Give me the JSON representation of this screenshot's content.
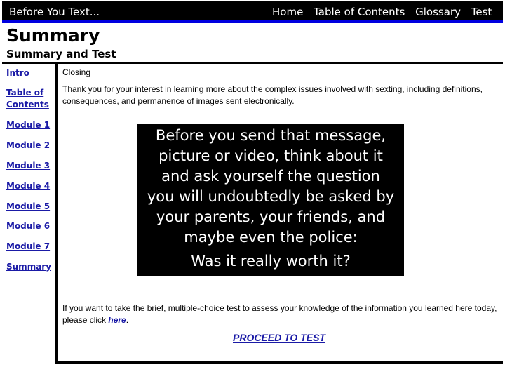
{
  "header": {
    "site_title": "Before You Text...",
    "nav": [
      "Home",
      "Table of Contents",
      "Glossary",
      "Test"
    ]
  },
  "page": {
    "title": "Summary",
    "subtitle": "Summary and Test"
  },
  "sidebar": {
    "items": [
      {
        "line1": "Intro",
        "line2": ""
      },
      {
        "line1": "Table of",
        "line2": "Contents"
      },
      {
        "line1": "Module 1",
        "line2": ""
      },
      {
        "line1": "Module 2",
        "line2": ""
      },
      {
        "line1": "Module 3",
        "line2": ""
      },
      {
        "line1": "Module 4",
        "line2": ""
      },
      {
        "line1": "Module 5",
        "line2": ""
      },
      {
        "line1": "Module 6",
        "line2": ""
      },
      {
        "line1": "Module 7",
        "line2": ""
      },
      {
        "line1": "Summary",
        "line2": ""
      }
    ]
  },
  "main": {
    "section_label": "Closing",
    "intro_text": "Thank you for your interest in learning more about the complex issues involved with sexting, including definitions, consequences, and permanence of images sent electronically.",
    "quote_lines": [
      "Before you send that message,",
      "picture or video, think about it",
      "and ask yourself the question",
      "you will undoubtedly be asked by",
      "your parents, your friends, and",
      "maybe even the police:"
    ],
    "quote_last": "Was it really worth it?",
    "test_text_before": "If you want to take the brief, multiple-choice test to assess your knowledge of the information you learned here today, please click ",
    "test_link": "here",
    "test_text_after": ".",
    "proceed_label": "PROCEED TO TEST"
  },
  "colors": {
    "link": "#1a1aa6",
    "header_bg": "#000000",
    "header_accent": "#0000e0"
  }
}
